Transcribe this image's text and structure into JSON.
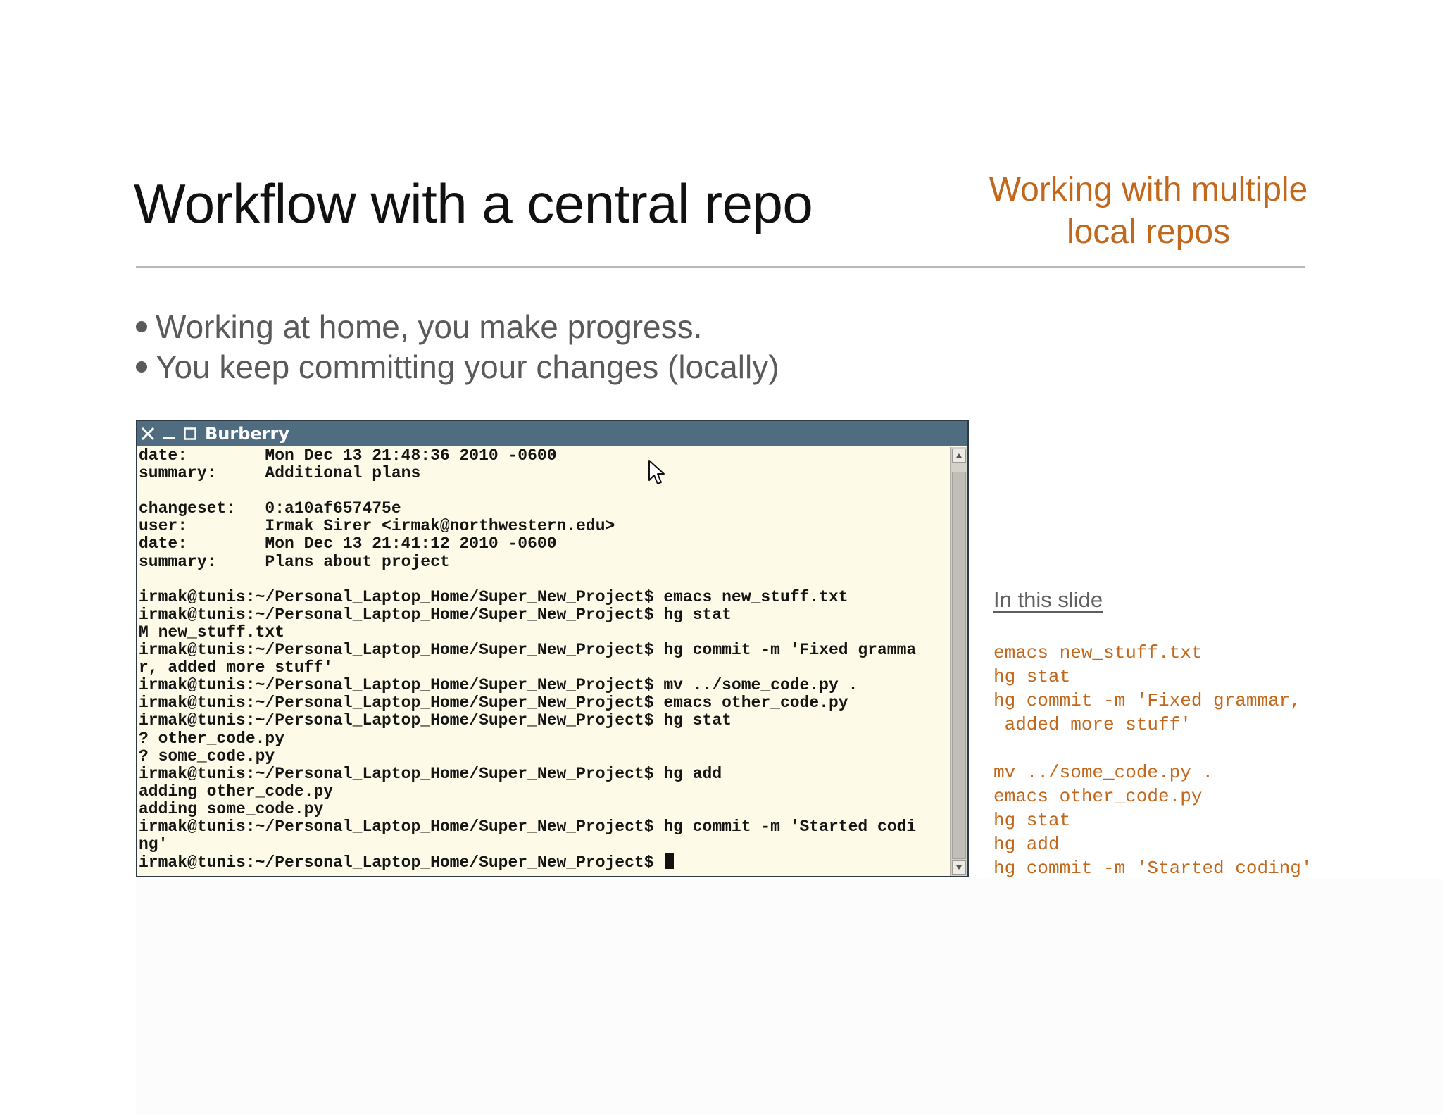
{
  "slide": {
    "title": "Workflow with a central repo",
    "section_label_lines": [
      "Working with multiple",
      "local repos"
    ],
    "bullets": [
      "Working at home, you make progress.",
      "You keep committing your changes (locally)"
    ]
  },
  "terminal": {
    "window_title": "Burberry",
    "lines": [
      "date:        Mon Dec 13 21:48:36 2010 -0600",
      "summary:     Additional plans",
      "",
      "changeset:   0:a10af657475e",
      "user:        Irmak Sirer <irmak@northwestern.edu>",
      "date:        Mon Dec 13 21:41:12 2010 -0600",
      "summary:     Plans about project",
      "",
      "irmak@tunis:~/Personal_Laptop_Home/Super_New_Project$ emacs new_stuff.txt",
      "irmak@tunis:~/Personal_Laptop_Home/Super_New_Project$ hg stat",
      "M new_stuff.txt",
      "irmak@tunis:~/Personal_Laptop_Home/Super_New_Project$ hg commit -m 'Fixed gramma",
      "r, added more stuff'",
      "irmak@tunis:~/Personal_Laptop_Home/Super_New_Project$ mv ../some_code.py .",
      "irmak@tunis:~/Personal_Laptop_Home/Super_New_Project$ emacs other_code.py",
      "irmak@tunis:~/Personal_Laptop_Home/Super_New_Project$ hg stat",
      "? other_code.py",
      "? some_code.py",
      "irmak@tunis:~/Personal_Laptop_Home/Super_New_Project$ hg add",
      "adding other_code.py",
      "adding some_code.py",
      "irmak@tunis:~/Personal_Laptop_Home/Super_New_Project$ hg commit -m 'Started codi",
      "ng'",
      "irmak@tunis:~/Personal_Laptop_Home/Super_New_Project$ "
    ],
    "scroll_position": 1.0
  },
  "side_panel": {
    "heading": "In this slide",
    "commands": [
      "emacs new_stuff.txt",
      "hg stat",
      "hg commit -m 'Fixed grammar,",
      " added more stuff'",
      "",
      "mv ../some_code.py .",
      "emacs other_code.py",
      "hg stat",
      "hg add",
      "hg commit -m 'Started coding'"
    ]
  },
  "colors": {
    "accent": "#c2681d",
    "titlebar": "#4f6c80",
    "terminal_bg": "#fdfbe8"
  },
  "icons": [
    "close-icon",
    "minimize-icon",
    "maximize-icon",
    "mouse-pointer-icon",
    "scroll-up-icon",
    "scroll-down-icon"
  ]
}
